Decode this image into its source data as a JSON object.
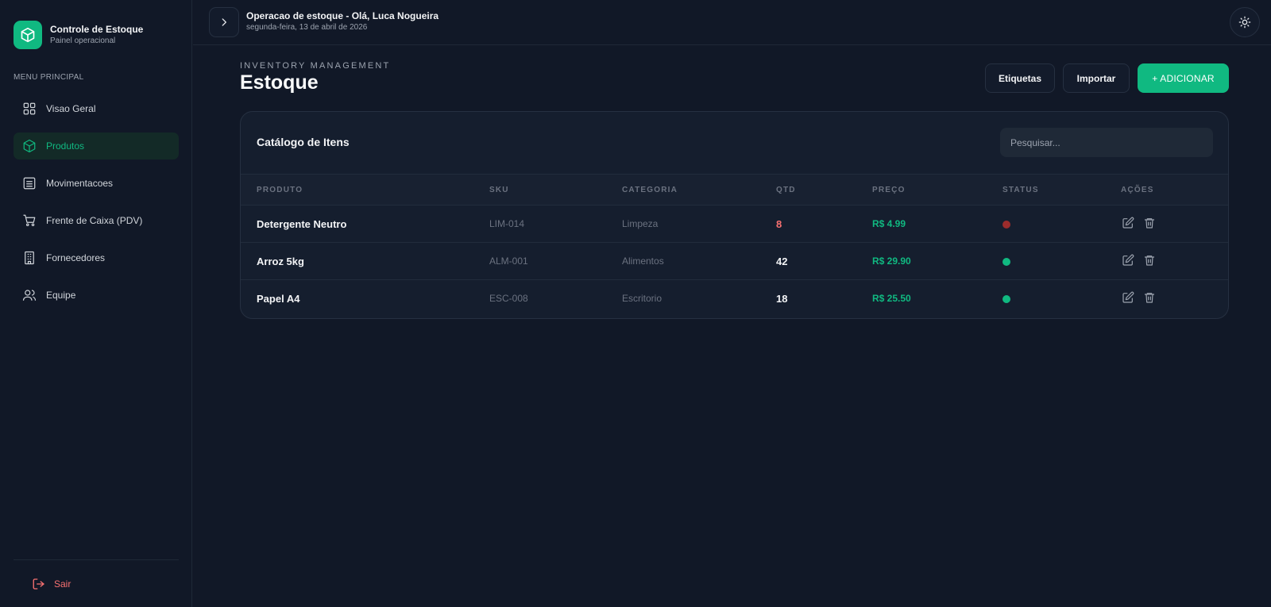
{
  "brand": {
    "title": "Controle de Estoque",
    "subtitle": "Painel operacional"
  },
  "sidebar": {
    "menu_header": "MENU PRINCIPAL",
    "items": [
      {
        "label": "Visao Geral",
        "icon": "grid-icon",
        "active": false
      },
      {
        "label": "Produtos",
        "icon": "box-icon",
        "active": true
      },
      {
        "label": "Movimentacoes",
        "icon": "list-icon",
        "active": false
      },
      {
        "label": "Frente de Caixa (PDV)",
        "icon": "cart-icon",
        "active": false
      },
      {
        "label": "Fornecedores",
        "icon": "building-icon",
        "active": false
      },
      {
        "label": "Equipe",
        "icon": "users-icon",
        "active": false
      }
    ],
    "logout_label": "Sair"
  },
  "topbar": {
    "title": "Operacao de estoque - Olá, Luca Nogueira",
    "date": "segunda-feira, 13 de abril de 2026"
  },
  "page": {
    "overline": "INVENTORY MANAGEMENT",
    "title": "Estoque",
    "buttons": {
      "labels": "Etiquetas",
      "import": "Importar",
      "add": "+ ADICIONAR"
    }
  },
  "catalog": {
    "title": "Catálogo de Itens",
    "search_placeholder": "Pesquisar...",
    "columns": [
      "PRODUTO",
      "SKU",
      "CATEGORIA",
      "QTD",
      "PREÇO",
      "STATUS",
      "AÇÕES"
    ],
    "rows": [
      {
        "produto": "Detergente Neutro",
        "sku": "LIM-014",
        "categoria": "Limpeza",
        "qtd": "8",
        "preco": "R$ 4.99",
        "status": "low"
      },
      {
        "produto": "Arroz 5kg",
        "sku": "ALM-001",
        "categoria": "Alimentos",
        "qtd": "42",
        "preco": "R$ 29.90",
        "status": "ok"
      },
      {
        "produto": "Papel A4",
        "sku": "ESC-008",
        "categoria": "Escritorio",
        "qtd": "18",
        "preco": "R$ 25.50",
        "status": "ok"
      }
    ]
  },
  "colors": {
    "accent": "#10b981",
    "danger": "#f87171",
    "status_low": "#9b2c2c",
    "status_ok": "#10b981",
    "background": "#111827"
  }
}
